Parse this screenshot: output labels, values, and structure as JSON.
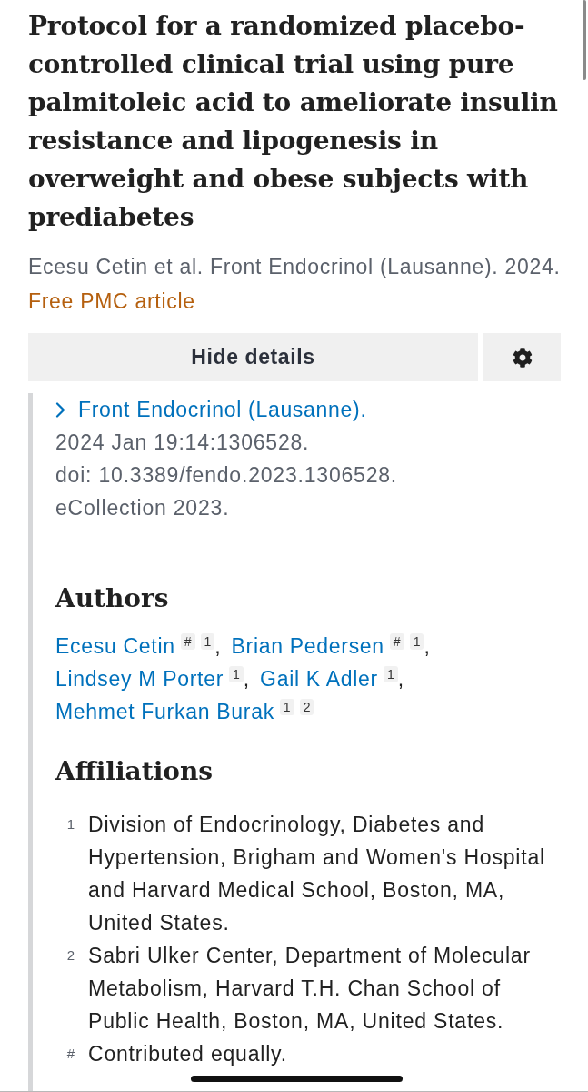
{
  "article": {
    "title": "Protocol for a randomized placebo-controlled clinical trial using pure palmitoleic acid to ameliorate insulin resistance and lipogenesis in overweight and obese subjects with prediabetes",
    "citation": "Ecesu Cetin et al. Front Endocrinol (Lausanne). 2024.",
    "free_link": "Free PMC article"
  },
  "toolbar": {
    "details_button": "Hide details"
  },
  "details": {
    "journal_link": "Front Endocrinol (Lausanne).",
    "lines": [
      "2024 Jan 19:14:1306528.",
      "doi: 10.3389/fendo.2023.1306528.",
      "eCollection 2023."
    ]
  },
  "authors": {
    "heading": "Authors",
    "items": [
      {
        "name": "Ecesu Cetin",
        "marks": [
          "#",
          "1"
        ],
        "separator": ","
      },
      {
        "name": "Brian Pedersen",
        "marks": [
          "#",
          "1"
        ],
        "separator": ","
      },
      {
        "name": "Lindsey M Porter",
        "marks": [
          "1"
        ],
        "separator": ","
      },
      {
        "name": "Gail K Adler",
        "marks": [
          "1"
        ],
        "separator": ","
      },
      {
        "name": "Mehmet Furkan Burak",
        "marks": [
          "1",
          "2"
        ]
      }
    ]
  },
  "affiliations": {
    "heading": "Affiliations",
    "items": [
      {
        "marker": "1",
        "text": "Division of Endocrinology, Diabetes and Hypertension, Brigham and Women's Hospital and Harvard Medical School, Boston, MA, United States."
      },
      {
        "marker": "2",
        "text": "Sabri Ulker Center, Department of Molecular Metabolism, Harvard T.H. Chan School of Public Health, Boston, MA, United States."
      },
      {
        "marker": "#",
        "text": "Contributed equally."
      }
    ]
  }
}
